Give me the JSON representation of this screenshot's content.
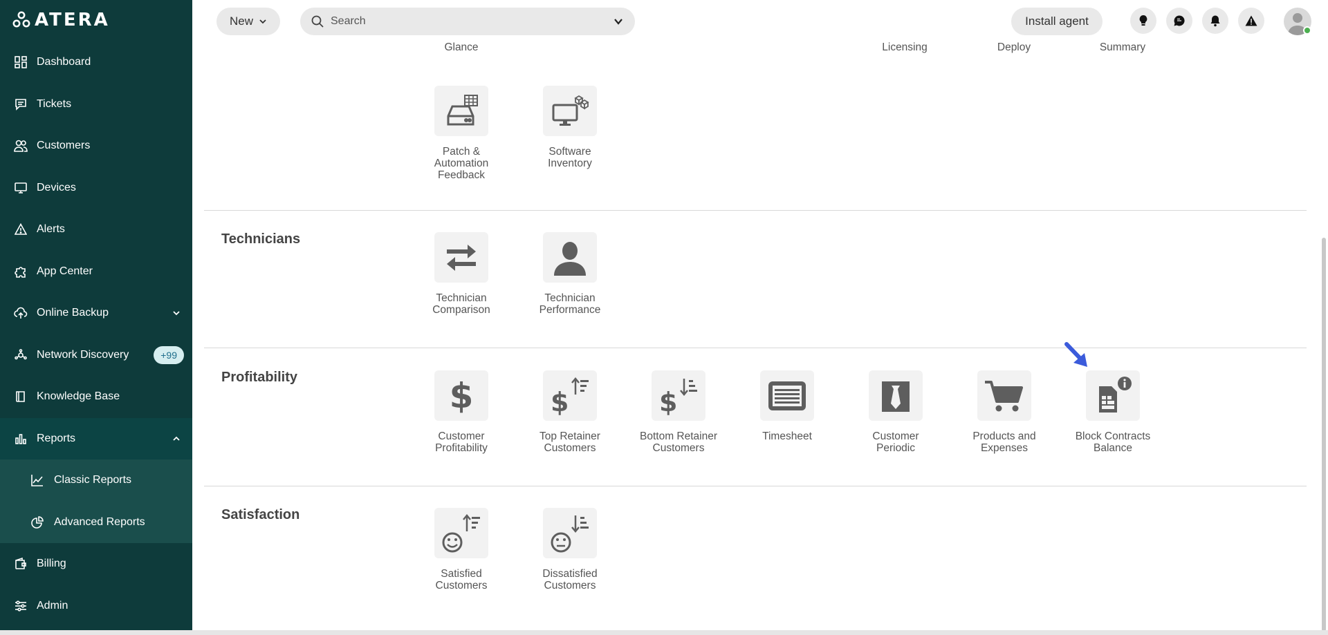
{
  "brand": {
    "logo_text": "ATERA"
  },
  "sidebar": {
    "items": [
      {
        "label": "Dashboard",
        "icon": "dashboard-icon"
      },
      {
        "label": "Tickets",
        "icon": "tickets-icon"
      },
      {
        "label": "Customers",
        "icon": "customers-icon"
      },
      {
        "label": "Devices",
        "icon": "devices-icon"
      },
      {
        "label": "Alerts",
        "icon": "alerts-icon"
      },
      {
        "label": "App Center",
        "icon": "puzzle-icon"
      },
      {
        "label": "Online Backup",
        "icon": "cloud-backup-icon"
      },
      {
        "label": "Network Discovery",
        "icon": "network-icon",
        "badge": "+99"
      },
      {
        "label": "Knowledge Base",
        "icon": "book-icon"
      },
      {
        "label": "Reports",
        "icon": "reports-icon"
      },
      {
        "label": "Classic Reports",
        "icon": "line-chart-icon"
      },
      {
        "label": "Advanced Reports",
        "icon": "pie-chart-icon"
      },
      {
        "label": "Billing",
        "icon": "wallet-icon"
      },
      {
        "label": "Admin",
        "icon": "sliders-icon"
      }
    ]
  },
  "topbar": {
    "new_label": "New",
    "search_placeholder": "Search",
    "install_label": "Install agent"
  },
  "top_partial_labels": [
    "Glance",
    "Licensing",
    "Deploy",
    "Summary"
  ],
  "sections": {
    "first_row": [
      {
        "label": "Patch & Automation Feedback",
        "icon": "patch-automation-icon"
      },
      {
        "label": "Software Inventory",
        "icon": "software-inventory-icon"
      }
    ],
    "technicians": {
      "title": "Technicians",
      "tiles": [
        {
          "label": "Technician Comparison",
          "icon": "swap-arrows-icon"
        },
        {
          "label": "Technician Performance",
          "icon": "person-icon"
        }
      ]
    },
    "profitability": {
      "title": "Profitability",
      "tiles": [
        {
          "label": "Customer Profitability",
          "icon": "dollar-icon"
        },
        {
          "label": "Top Retainer Customers",
          "icon": "dollar-sort-up-icon"
        },
        {
          "label": "Bottom Retainer Customers",
          "icon": "dollar-sort-down-icon"
        },
        {
          "label": "Timesheet",
          "icon": "timesheet-icon"
        },
        {
          "label": "Customer Periodic",
          "icon": "tie-icon"
        },
        {
          "label": "Products and Expenses",
          "icon": "cart-icon"
        },
        {
          "label": "Block Contracts Balance",
          "icon": "contract-info-icon"
        }
      ]
    },
    "satisfaction": {
      "title": "Satisfaction",
      "tiles": [
        {
          "label": "Satisfied Customers",
          "icon": "smile-sort-up-icon"
        },
        {
          "label": "Dissatisfied Customers",
          "icon": "neutral-sort-down-icon"
        }
      ]
    }
  },
  "colors": {
    "sidebar_bg": "#0e3b3b",
    "sidebar_sub_bg": "#1a4e4c",
    "tile_bg": "#f2f2f2",
    "icon_gray": "#5e5e5e",
    "pointer_arrow": "#3b5bdb",
    "online_dot": "#4caf50"
  }
}
